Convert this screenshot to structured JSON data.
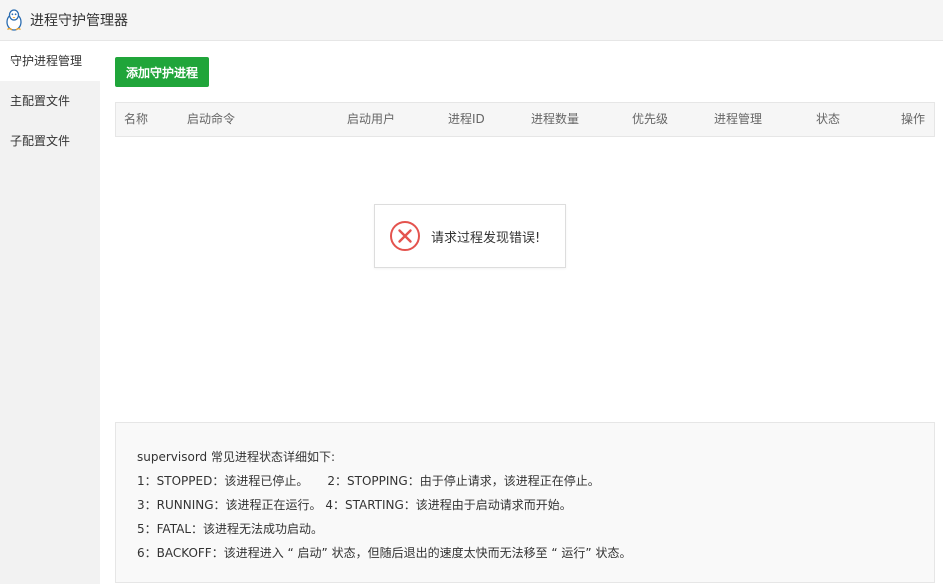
{
  "app": {
    "title": "进程守护管理器",
    "icon": "penguin-icon"
  },
  "sidebar": {
    "items": [
      {
        "label": "守护进程管理",
        "active": true
      },
      {
        "label": "主配置文件",
        "active": false
      },
      {
        "label": "子配置文件",
        "active": false
      }
    ]
  },
  "toolbar": {
    "add_label": "添加守护进程",
    "accent": "#20a53a"
  },
  "table": {
    "columns": [
      "名称",
      "启动命令",
      "启动用户",
      "进程ID",
      "进程数量",
      "优先级",
      "进程管理",
      "状态",
      "操作"
    ]
  },
  "error": {
    "message": "请求过程发现错误!",
    "icon": "error-x-icon",
    "color": "#e4534e"
  },
  "info": {
    "lines": [
      "supervisord 常见进程状态详细如下:",
      "1：STOPPED：该进程已停止。     2：STOPPING：由于停止请求，该进程正在停止。",
      "3：RUNNING：该进程正在运行。 4：STARTING：该进程由于启动请求而开始。",
      "5：FATAL：该进程无法成功启动。",
      "6：BACKOFF：该进程进入 “ 启动” 状态，但随后退出的速度太快而无法移至 “ 运行” 状态。"
    ]
  }
}
